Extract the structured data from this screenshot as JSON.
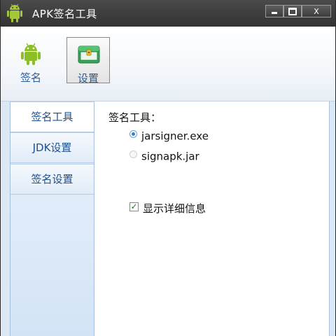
{
  "window": {
    "title": "APK签名工具",
    "controls": {
      "minimize": "minimize",
      "maximize": "maximize",
      "close": "X"
    }
  },
  "toolbar": {
    "items": [
      {
        "label": "签名",
        "icon": "android-robot-icon"
      },
      {
        "label": "设置",
        "icon": "settings-chest-icon"
      }
    ]
  },
  "nav": {
    "items": [
      {
        "label": "签名工具",
        "active": true
      },
      {
        "label": "JDK设置",
        "active": false
      },
      {
        "label": "签名设置",
        "active": false
      }
    ]
  },
  "panel": {
    "section_label": "签名工具：",
    "options": [
      {
        "label": "jarsigner.exe",
        "checked": true
      },
      {
        "label": "signapk.jar",
        "checked": false
      }
    ],
    "verbose_label": "显示详细信息",
    "verbose_checked": true
  },
  "colors": {
    "title_bar": "#3b3b3b",
    "accent": "#2a5d9b",
    "radio_dot": "#3a7bd5",
    "check_mark": "#1f7f1f"
  }
}
